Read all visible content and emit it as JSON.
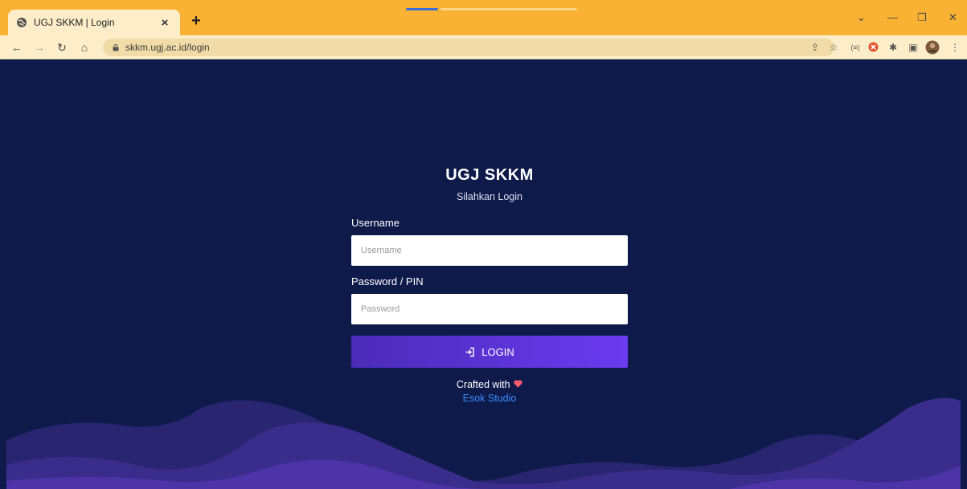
{
  "browser": {
    "tab_title": "UGJ SKKM | Login",
    "tab_close": "×",
    "new_tab": "+",
    "url": "skkm.ugj.ac.id/login",
    "window": {
      "minimize": "—",
      "restore": "❐",
      "close": "✕",
      "tablist": "⌄"
    },
    "icons": [
      "share-icon",
      "star-icon",
      "cast-icon",
      "extension-blocked-icon",
      "puzzle-icon",
      "sidepanel-icon",
      "profile-avatar",
      "menu-icon"
    ]
  },
  "page": {
    "app_title": "UGJ SKKM",
    "subtitle": "Silahkan Login",
    "username_label": "Username",
    "username_placeholder": "Username",
    "password_label": "Password / PIN",
    "password_placeholder": "Password",
    "login_label": "LOGIN",
    "credit_text": "Crafted with",
    "studio_name": "Esok Studio"
  },
  "colors": {
    "background": "#0e1a4a",
    "button_start": "#4b2bb8",
    "button_end": "#6a3bf0",
    "link": "#3d8bff",
    "heart": "#ff5a6e",
    "chrome": "#f9b233"
  }
}
